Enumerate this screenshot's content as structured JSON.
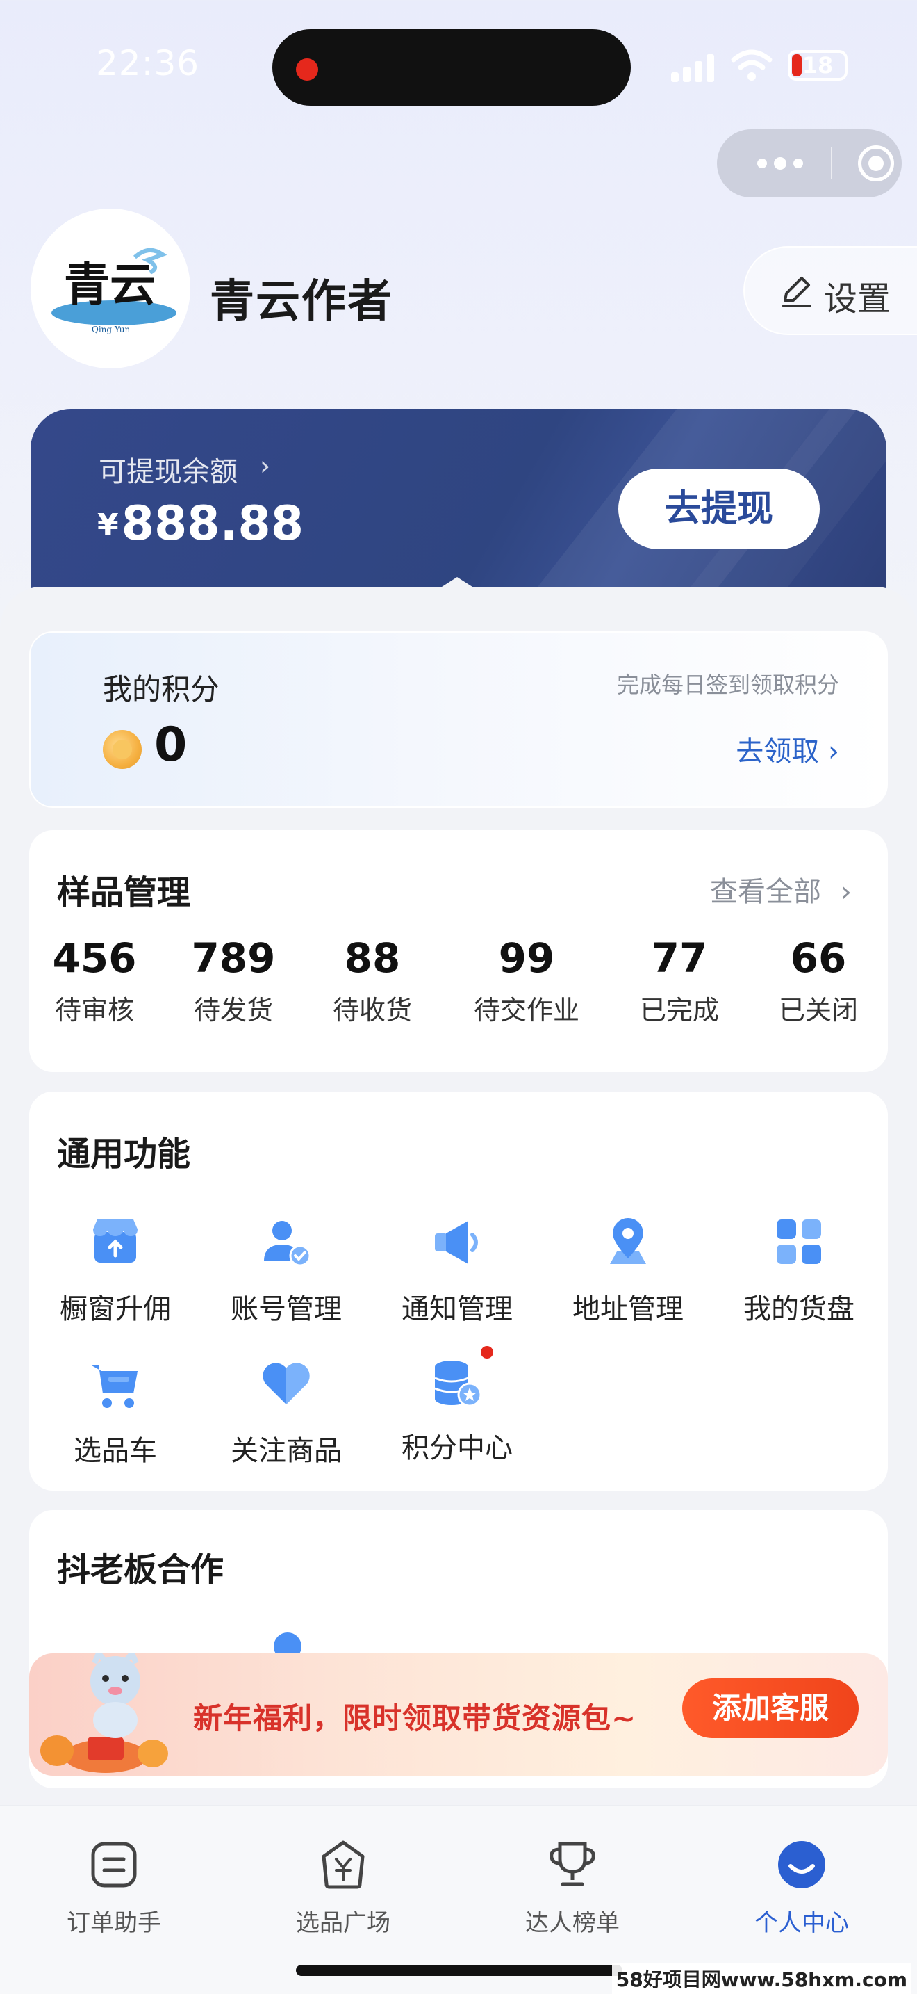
{
  "status_bar": {
    "time": "22:36",
    "battery": "18"
  },
  "profile": {
    "nickname": "青云作者",
    "settings_label": "设置",
    "avatar_text": "青云",
    "avatar_subtext": "Qing Yun"
  },
  "balance": {
    "label": "可提现余额",
    "currency": "¥",
    "amount": "888.88",
    "withdraw_label": "去提现"
  },
  "points": {
    "title": "我的积分",
    "value": "0",
    "hint": "完成每日签到领取积分",
    "claim_label": "去领取 ›"
  },
  "samples": {
    "title": "样品管理",
    "view_all": "查看全部",
    "stats": [
      {
        "count": "456",
        "label": "待审核"
      },
      {
        "count": "789",
        "label": "待发货"
      },
      {
        "count": "88",
        "label": "待收货"
      },
      {
        "count": "99",
        "label": "待交作业"
      },
      {
        "count": "77",
        "label": "已完成"
      },
      {
        "count": "66",
        "label": "已关闭"
      }
    ]
  },
  "functions": {
    "title": "通用功能",
    "items": [
      {
        "label": "橱窗升佣",
        "icon": "storefront-icon"
      },
      {
        "label": "账号管理",
        "icon": "user-check-icon"
      },
      {
        "label": "通知管理",
        "icon": "megaphone-icon"
      },
      {
        "label": "地址管理",
        "icon": "location-pin-icon"
      },
      {
        "label": "我的货盘",
        "icon": "grid-icon"
      },
      {
        "label": "选品车",
        "icon": "cart-icon"
      },
      {
        "label": "关注商品",
        "icon": "heart-icon"
      },
      {
        "label": "积分中心",
        "icon": "coin-stack-icon"
      }
    ]
  },
  "cooperation": {
    "title": "抖老板合作"
  },
  "promo": {
    "text": "新年福利，限时领取带货资源包~",
    "button": "添加客服"
  },
  "tabbar": {
    "tabs": [
      {
        "label": "订单助手",
        "icon": "order-icon",
        "active": false
      },
      {
        "label": "选品广场",
        "icon": "yen-tag-icon",
        "active": false
      },
      {
        "label": "达人榜单",
        "icon": "trophy-icon",
        "active": false
      },
      {
        "label": "个人中心",
        "icon": "profile-smile-icon",
        "active": true
      }
    ]
  },
  "colors": {
    "primary": "#2b5fd1",
    "balance_bg": "#2f4581",
    "promo_red": "#d8322a",
    "promo_button": "#f0441b"
  },
  "watermark": "58好项目网www.58hxm.com"
}
